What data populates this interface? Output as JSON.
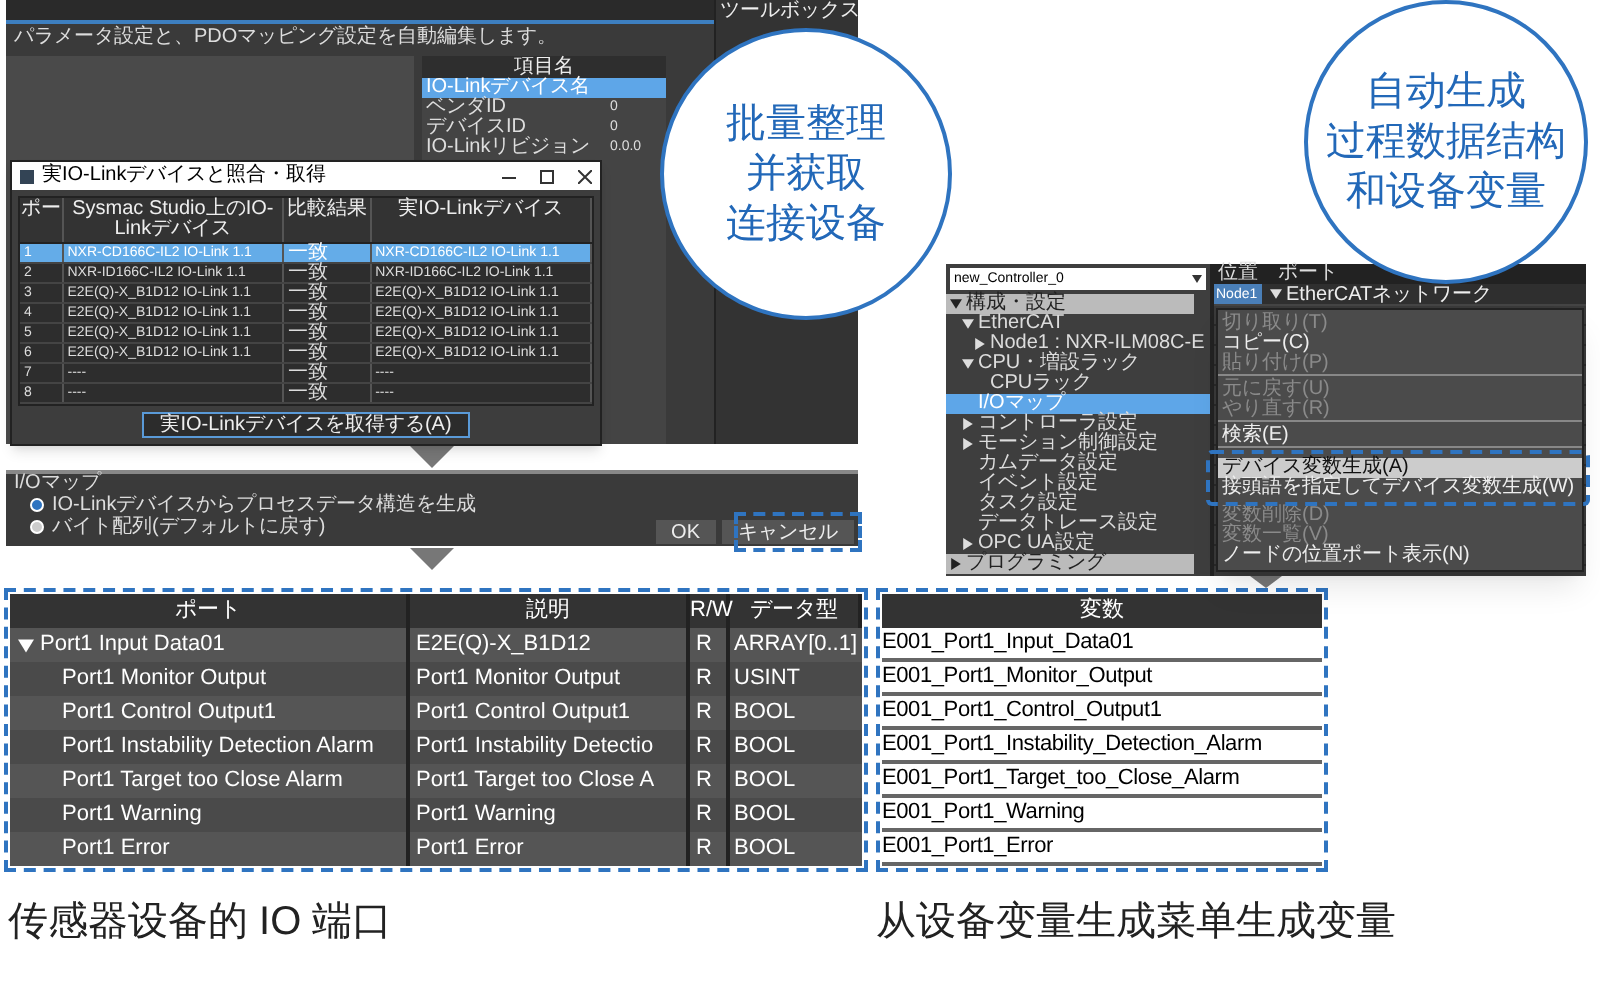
{
  "left_screenshot": {
    "description": "パラメータ設定と、PDOマッピング設定を自動編集します。",
    "toolbox_title": "ツールボックス",
    "properties": {
      "header": "項目名",
      "rows": [
        {
          "name": "IO-Linkデバイス名",
          "selected": true
        },
        {
          "name": "ベンダID",
          "value": "0",
          "selected": false
        },
        {
          "name": "デバイスID",
          "value": "0",
          "selected": false
        },
        {
          "name": "IO-Linkリビジョン",
          "value": "0.0.0",
          "selected": false
        }
      ]
    },
    "dialog": {
      "title": "実IO-Linkデバイスと照合・取得",
      "columns": [
        "ポー",
        "Sysmac Studio上のIO-Linkデバイス",
        "比較結果",
        "実IO-Linkデバイス"
      ],
      "rows": [
        {
          "cells": [
            "1",
            "NXR-CD166C-IL2 IO-Link 1.1",
            "一致",
            "NXR-CD166C-IL2 IO-Link 1.1"
          ],
          "selected": true
        },
        {
          "cells": [
            "2",
            "NXR-ID166C-IL2 IO-Link 1.1",
            "一致",
            "NXR-ID166C-IL2 IO-Link 1.1"
          ],
          "selected": false
        },
        {
          "cells": [
            "3",
            "E2E(Q)-X_B1D12 IO-Link 1.1",
            "一致",
            "E2E(Q)-X_B1D12 IO-Link 1.1"
          ],
          "selected": false
        },
        {
          "cells": [
            "4",
            "E2E(Q)-X_B1D12 IO-Link 1.1",
            "一致",
            "E2E(Q)-X_B1D12 IO-Link 1.1"
          ],
          "selected": false
        },
        {
          "cells": [
            "5",
            "E2E(Q)-X_B1D12 IO-Link 1.1",
            "一致",
            "E2E(Q)-X_B1D12 IO-Link 1.1"
          ],
          "selected": false
        },
        {
          "cells": [
            "6",
            "E2E(Q)-X_B1D12 IO-Link 1.1",
            "一致",
            "E2E(Q)-X_B1D12 IO-Link 1.1"
          ],
          "selected": false
        },
        {
          "cells": [
            "7",
            "----",
            "一致",
            "----"
          ],
          "selected": false
        },
        {
          "cells": [
            "8",
            "----",
            "一致",
            "----"
          ],
          "selected": false
        }
      ],
      "button": "実IO-Linkデバイスを取得する(A)"
    },
    "callout": [
      "批量整理",
      "并获取",
      "连接设备"
    ]
  },
  "io_map": {
    "title": "I/Oマップ",
    "options": [
      {
        "label": "IO-Linkデバイスからプロセスデータ構造を生成",
        "selected": true
      },
      {
        "label": "バイト配列(デフォルトに戻す)",
        "selected": false
      }
    ],
    "buttons": [
      "OK",
      "キャンセル"
    ]
  },
  "right_screenshot": {
    "controller": "new_Controller_0",
    "tree": [
      {
        "label": "構成・設定",
        "kind": "section",
        "expanded": true,
        "selected": false,
        "children": [
          {
            "label": "EtherCAT",
            "kind": "item",
            "expanded": true,
            "selected": false,
            "children": [
              {
                "label": "Node1 : NXR-ILM08C-E",
                "kind": "item",
                "expanded": false,
                "selected": false
              }
            ]
          },
          {
            "label": "CPU・増設ラック",
            "kind": "item",
            "expanded": true,
            "selected": false,
            "children": [
              {
                "label": "CPUラック",
                "kind": "item",
                "selected": false
              }
            ]
          },
          {
            "label": "I/Oマップ",
            "kind": "item",
            "selected": true
          },
          {
            "label": "コントローラ設定",
            "kind": "item",
            "expanded": false,
            "selected": false
          },
          {
            "label": "モーション制御設定",
            "kind": "item",
            "expanded": false,
            "selected": false
          },
          {
            "label": "カムデータ設定",
            "kind": "item",
            "selected": false
          },
          {
            "label": "イベント設定",
            "kind": "item",
            "selected": false
          },
          {
            "label": "タスク設定",
            "kind": "item",
            "selected": false
          },
          {
            "label": "データトレース設定",
            "kind": "item",
            "selected": false
          },
          {
            "label": "OPC UA設定",
            "kind": "item",
            "expanded": false,
            "selected": false
          }
        ]
      },
      {
        "label": "プログラミング",
        "kind": "section",
        "expanded": false,
        "selected": false
      }
    ],
    "grid_columns": [
      "位置",
      "ポート"
    ],
    "grid_rows": [
      {
        "position": "Node1",
        "port": "EtherCATネットワーク",
        "expanded": true
      }
    ],
    "context_menu": [
      {
        "label": "切り取り(T)",
        "disabled": true,
        "selected": false,
        "separator_after": false
      },
      {
        "label": "コピー(C)",
        "disabled": false,
        "selected": false,
        "separator_after": false
      },
      {
        "label": "貼り付け(P)",
        "disabled": true,
        "selected": false,
        "separator_after": true
      },
      {
        "label": "元に戻す(U)",
        "disabled": true,
        "selected": false,
        "separator_after": false
      },
      {
        "label": "やり直す(R)",
        "disabled": true,
        "selected": false,
        "separator_after": true
      },
      {
        "label": "検索(E)",
        "disabled": false,
        "selected": false,
        "separator_after": true
      },
      {
        "label": "デバイス変数生成(A)",
        "disabled": false,
        "selected": true,
        "separator_after": false
      },
      {
        "label": "接頭語を指定してデバイス変数生成(W)",
        "disabled": false,
        "selected": false,
        "separator_after": false
      },
      {
        "label": "変数削除(D)",
        "disabled": true,
        "selected": false,
        "separator_after": false
      },
      {
        "label": "変数一覧(V)",
        "disabled": true,
        "selected": false,
        "separator_after": false
      },
      {
        "label": "ノードの位置ポート表示(N)",
        "disabled": false,
        "selected": false,
        "separator_after": false
      }
    ],
    "callout": [
      "自动生成",
      "过程数据结构",
      "和设备变量"
    ]
  },
  "port_table": {
    "columns": [
      "ポート",
      "説明",
      "R/W",
      "データ型"
    ],
    "rows": [
      {
        "port": "Port1 Input Data01",
        "description": "E2E(Q)-X_B1D12",
        "rw": "R",
        "type": "ARRAY[0..1]",
        "expanded": true,
        "children": [
          {
            "port": "Port1 Monitor Output",
            "description": "Port1 Monitor Output",
            "rw": "R",
            "type": "USINT"
          },
          {
            "port": "Port1 Control Output1",
            "description": "Port1 Control Output1",
            "rw": "R",
            "type": "BOOL"
          },
          {
            "port": "Port1 Instability Detection Alarm",
            "description": "Port1 Instability Detectio",
            "rw": "R",
            "type": "BOOL"
          },
          {
            "port": "Port1 Target too Close Alarm",
            "description": "Port1 Target too Close A",
            "rw": "R",
            "type": "BOOL"
          },
          {
            "port": "Port1 Warning",
            "description": "Port1 Warning",
            "rw": "R",
            "type": "BOOL"
          },
          {
            "port": "Port1 Error",
            "description": "Port1 Error",
            "rw": "R",
            "type": "BOOL"
          }
        ]
      }
    ]
  },
  "variable_table": {
    "column": "変数",
    "rows": [
      "E001_Port1_Input_Data01",
      "E001_Port1_Monitor_Output",
      "E001_Port1_Control_Output1",
      "E001_Port1_Instability_Detection_Alarm",
      "E001_Port1_Target_too_Close_Alarm",
      "E001_Port1_Warning",
      "E001_Port1_Error"
    ]
  },
  "captions": [
    "传感器设备的 IO 端口",
    "从设备变量生成菜单生成变量"
  ]
}
